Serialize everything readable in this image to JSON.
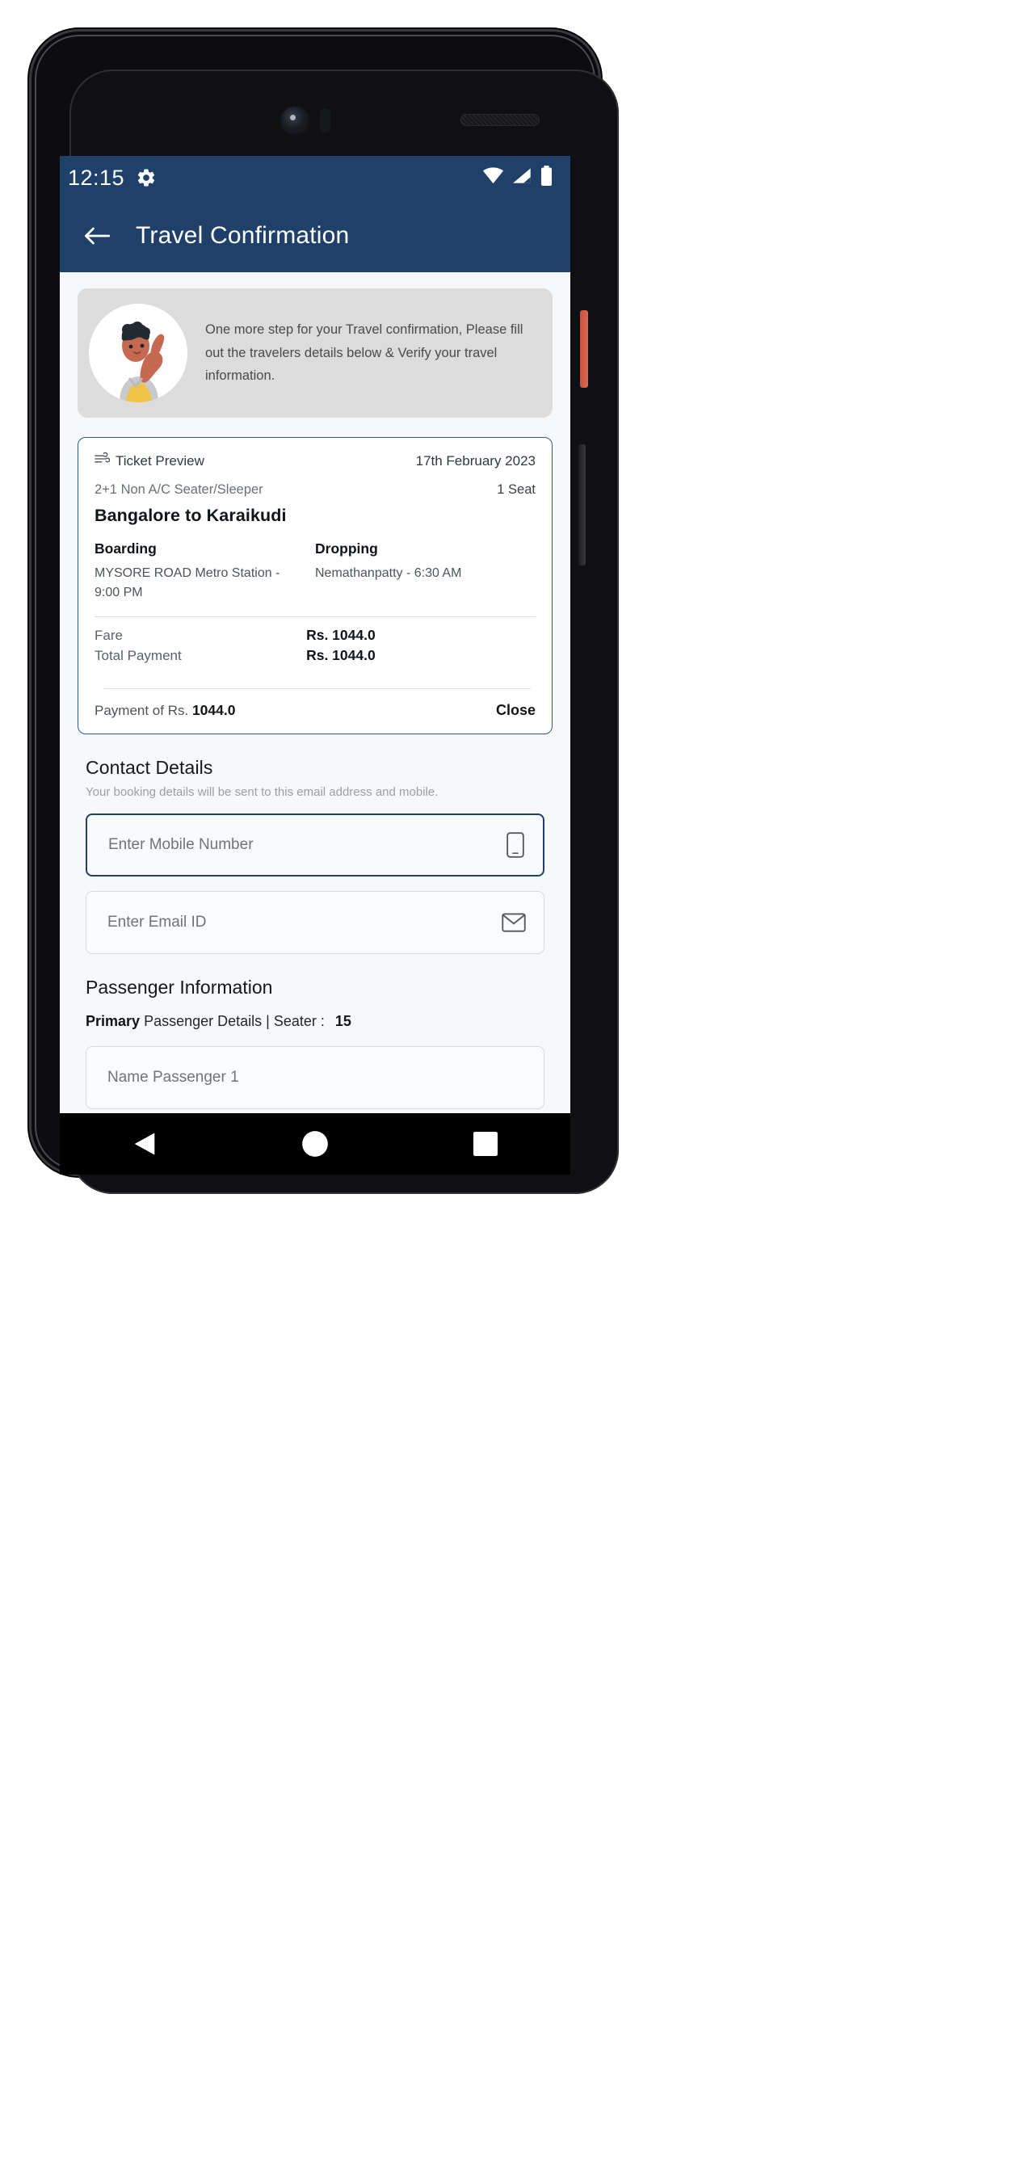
{
  "status_bar": {
    "time": "12:15",
    "gear_icon": "gear-icon",
    "wifi_icon": "wifi-icon",
    "signal_icon": "cellular-signal-icon",
    "battery_icon": "battery-icon"
  },
  "app_bar": {
    "back_icon": "back-arrow-icon",
    "title": "Travel Confirmation"
  },
  "info_banner": {
    "avatar_alt": "traveler-illustration",
    "text": "One more step for your Travel confirmation, Please fill out the travelers details below & Verify your travel information."
  },
  "ticket_card": {
    "preview_icon": "bus-icon",
    "preview_label": "Ticket Preview",
    "date": "17th February 2023",
    "bus_type": "2+1 Non A/C Seater/Sleeper",
    "seat_count": "1 Seat",
    "route": "Bangalore to Karaikudi",
    "boarding_label": "Boarding",
    "boarding_value": "MYSORE ROAD Metro Station - 9:00 PM",
    "dropping_label": "Dropping",
    "dropping_value": "Nemathanpatty - 6:30 AM",
    "fare_label": "Fare",
    "fare_value": "Rs. 1044.0",
    "total_label": "Total Payment",
    "total_value": "Rs. 1044.0",
    "payment_prefix": "Payment of Rs.",
    "payment_amount": "1044.0",
    "close_label": "Close"
  },
  "contact": {
    "heading": "Contact Details",
    "subtitle": "Your booking details will be sent to this email address and mobile.",
    "mobile_placeholder": "Enter Mobile Number",
    "mobile_icon": "mobile-phone-icon",
    "email_placeholder": "Enter Email ID",
    "email_icon": "envelope-icon"
  },
  "passenger": {
    "heading": "Passenger Information",
    "primary_label": "Primary",
    "details_label": "Passenger Details | Seater :",
    "seat_number": "15",
    "name_placeholder": "Name Passenger 1"
  },
  "nav_bar": {
    "back_icon": "nav-back-triangle-icon",
    "home_icon": "nav-home-circle-icon",
    "recents_icon": "nav-recents-square-icon"
  },
  "colors": {
    "app_bar": "#1f4068",
    "card_border": "#2d5a87",
    "banner_bg": "#dcdcdc",
    "screen_bg": "#f7f8f9"
  }
}
